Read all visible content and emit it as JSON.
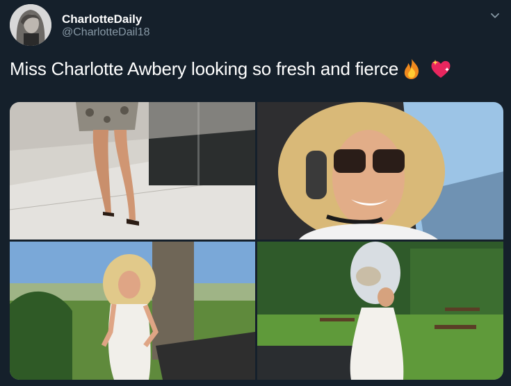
{
  "tweet": {
    "display_name": "CharlotteDaily",
    "handle": "@CharlotteDail18",
    "text": "Miss Charlotte Awbery looking so fresh and fierce",
    "emojis": [
      "fire-emoji",
      "sparkling-heart-emoji"
    ]
  },
  "icons": {
    "menu": "chevron-down-icon"
  },
  "colors": {
    "background": "#15202b",
    "text": "#ffffff",
    "secondary": "#8899a6"
  },
  "media": {
    "photos": [
      "legs-heels-photo",
      "cockpit-selfie-photo",
      "golf-course-dress-photo",
      "garden-hat-photo"
    ]
  }
}
